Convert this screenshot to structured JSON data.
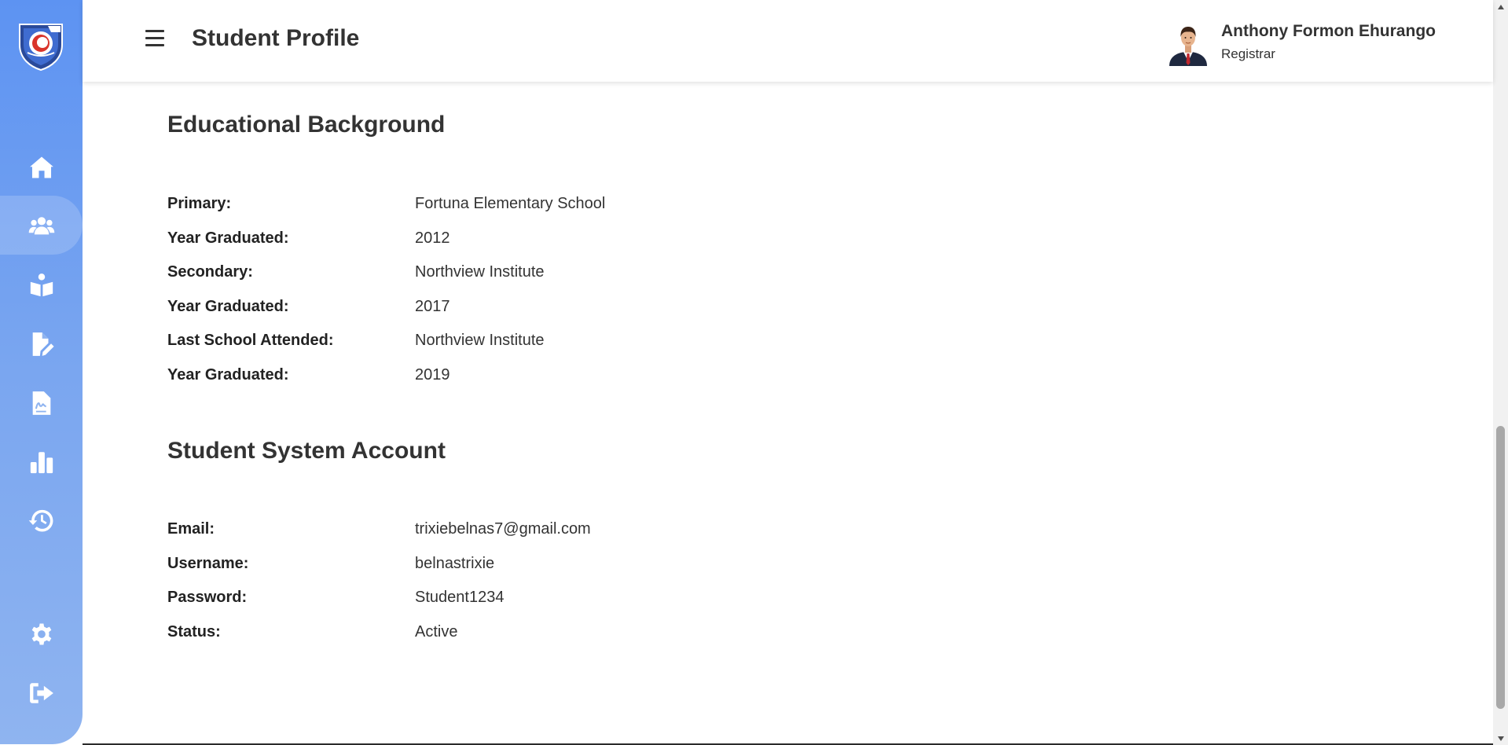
{
  "header": {
    "title": "Student Profile",
    "user_name": "Anthony Formon Ehurango",
    "user_role": "Registrar"
  },
  "sidebar": {
    "items": [
      {
        "icon": "home-icon",
        "active": false
      },
      {
        "icon": "users-icon",
        "active": true
      },
      {
        "icon": "reader-icon",
        "active": false
      },
      {
        "icon": "file-pen-icon",
        "active": false
      },
      {
        "icon": "file-signature-icon",
        "active": false
      },
      {
        "icon": "bar-chart-icon",
        "active": false
      },
      {
        "icon": "history-icon",
        "active": false
      },
      {
        "icon": "gear-icon",
        "active": false
      },
      {
        "icon": "sign-out-icon",
        "active": false
      }
    ],
    "accent_color": "#5d93f2"
  },
  "education": {
    "title": "Educational Background",
    "rows": [
      {
        "label": "Primary:",
        "value": "Fortuna Elementary School"
      },
      {
        "label": "Year Graduated:",
        "value": "2012"
      },
      {
        "label": "Secondary:",
        "value": "Northview Institute"
      },
      {
        "label": "Year Graduated:",
        "value": "2017"
      },
      {
        "label": "Last School Attended:",
        "value": "Northview Institute"
      },
      {
        "label": "Year Graduated:",
        "value": "2019"
      }
    ]
  },
  "account": {
    "title": "Student System Account",
    "rows": [
      {
        "label": "Email:",
        "value": "trixiebelnas7@gmail.com"
      },
      {
        "label": "Username:",
        "value": "belnastrixie"
      },
      {
        "label": "Password:",
        "value": "Student1234"
      },
      {
        "label": "Status:",
        "value": "Active"
      }
    ]
  }
}
